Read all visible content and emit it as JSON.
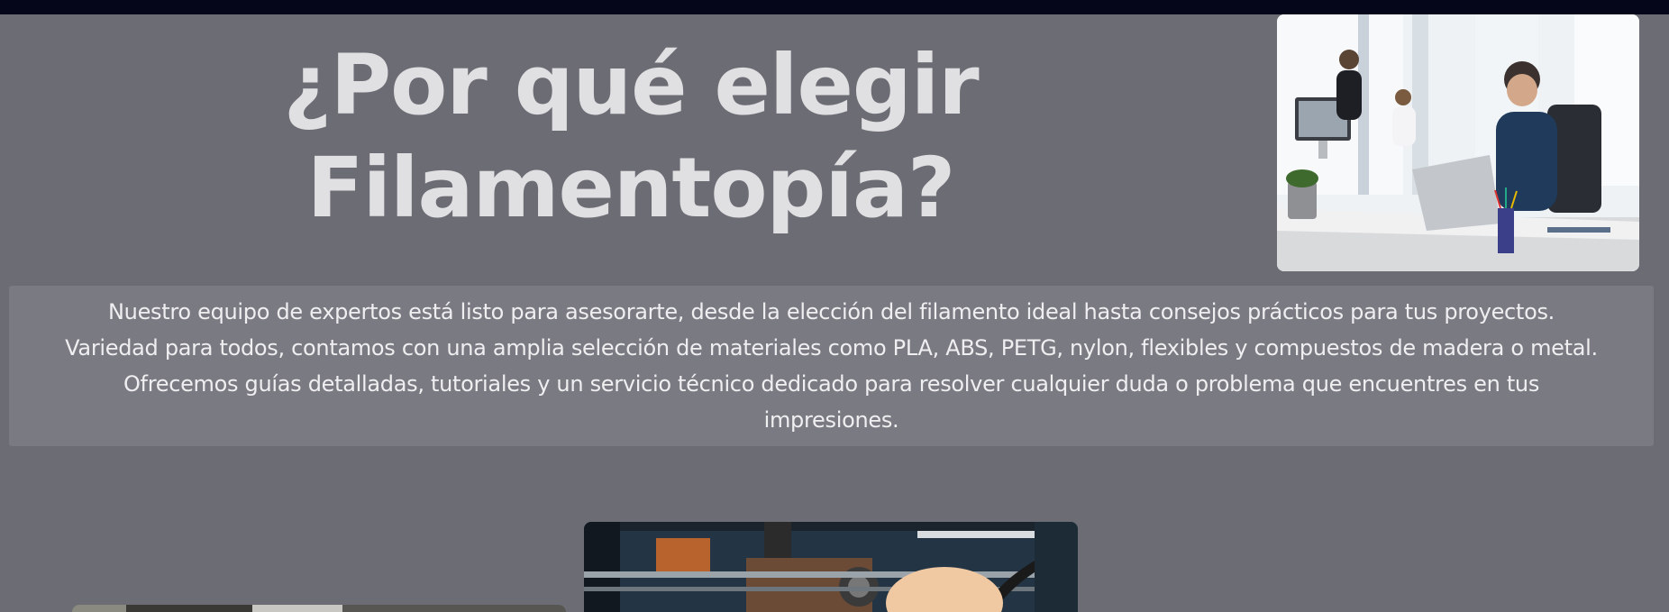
{
  "section": {
    "title_line1": "¿Por qué elegir",
    "title_line2": "Filamentopía?",
    "description_lines": [
      "Nuestro equipo de expertos está listo para asesorarte, desde la elección del filamento ideal hasta consejos prácticos para tus proyectos.",
      "Variedad para todos, contamos con una amplia selección de materiales como PLA, ABS, PETG, nylon, flexibles y compuestos de madera o metal.",
      "Ofrecemos guías detalladas, tutoriales y un servicio técnico dedicado para resolver cualquier duda o problema que encuentres en tus",
      "impresiones."
    ]
  },
  "colors": {
    "page_background": "#6c6c75",
    "top_bar": "#06061a",
    "title_text": "#e0dfe1",
    "info_box": "#7a7a82"
  }
}
